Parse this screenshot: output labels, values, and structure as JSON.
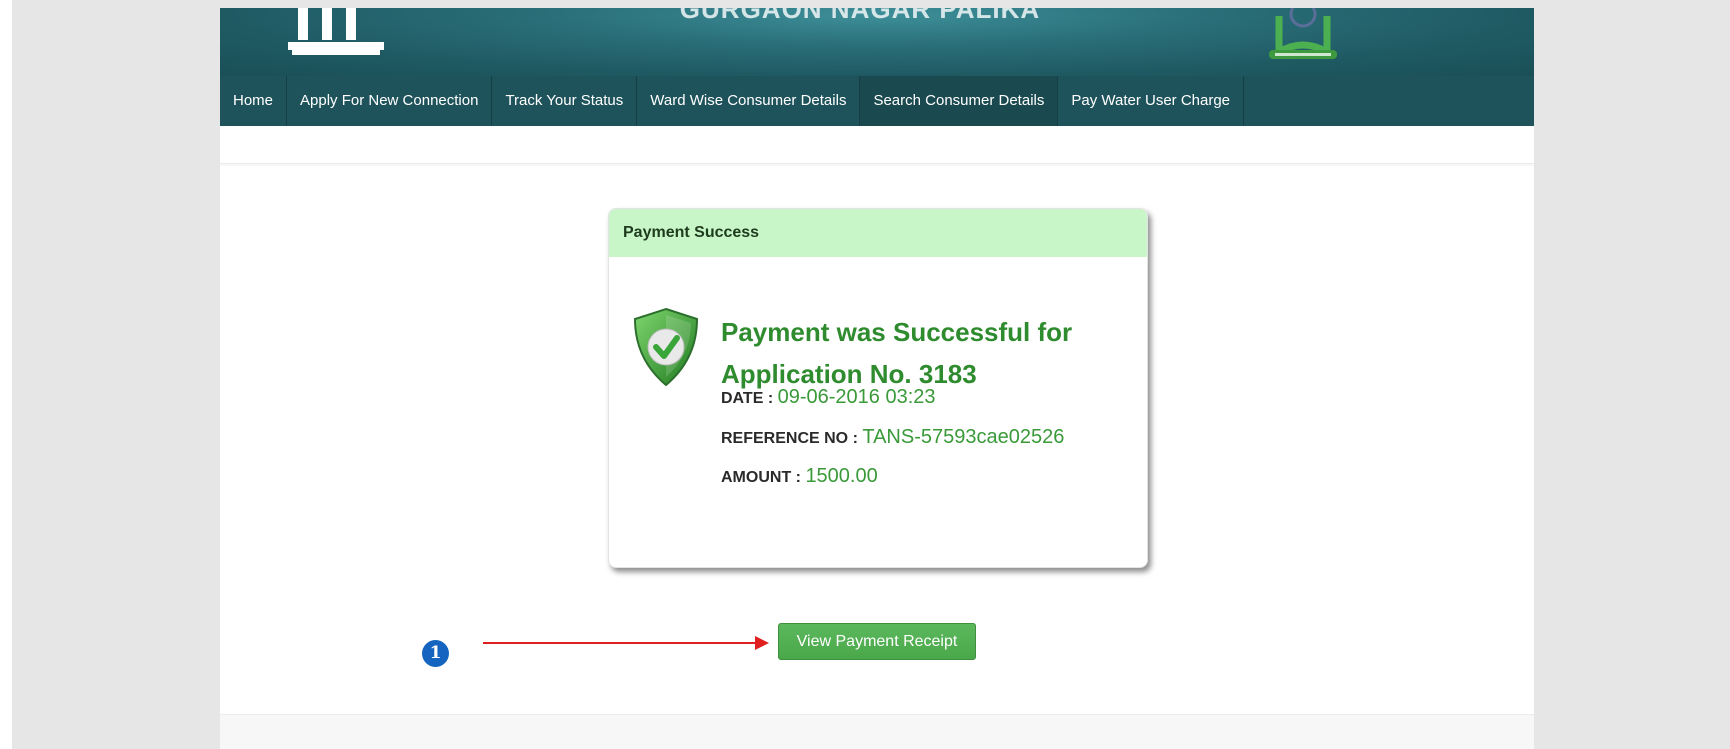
{
  "header": {
    "title": "GURGAON NAGAR PALIKA"
  },
  "nav": {
    "items": [
      {
        "label": "Home"
      },
      {
        "label": "Apply For New Connection"
      },
      {
        "label": "Track Your Status"
      },
      {
        "label": "Ward Wise Consumer Details"
      },
      {
        "label": "Search Consumer Details"
      },
      {
        "label": "Pay Water User Charge"
      }
    ]
  },
  "payment": {
    "heading": "Payment Success",
    "message": "Payment was Successful for Application No. 3183",
    "date_label": "DATE :",
    "date_value": "09-06-2016 03:23",
    "reference_label": "REFERENCE NO :",
    "reference_value": "TANS-57593cae02526",
    "amount_label": "AMOUNT :",
    "amount_value": "1500.00",
    "receipt_button": "View Payment Receipt"
  },
  "annotation": {
    "callout_number": "1"
  },
  "colors": {
    "banner": "#2a6f79",
    "nav": "#1f535b",
    "success_green": "#2e8b2e",
    "card_header": "#c8f6c8",
    "button": "#5cb85c",
    "arrow": "#e02020",
    "callout": "#1565c0"
  }
}
